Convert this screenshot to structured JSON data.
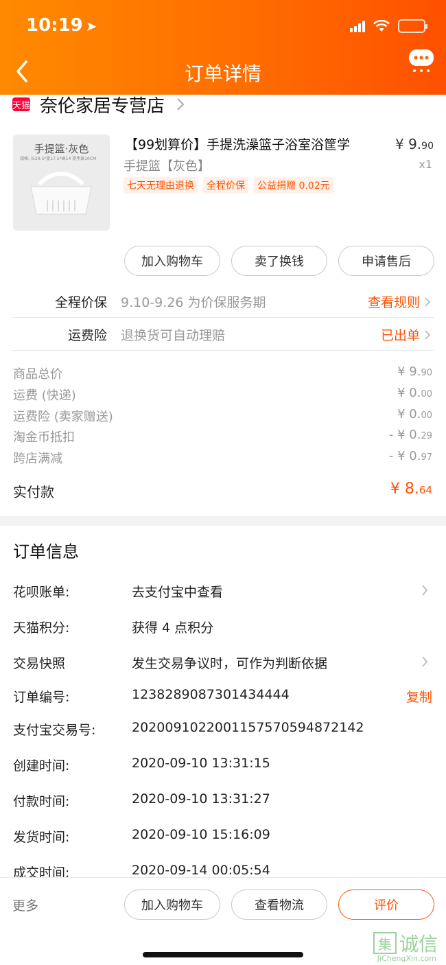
{
  "status_bar": {
    "time": "10:19",
    "location_glyph": "➤"
  },
  "header": {
    "title": "订单详情"
  },
  "store": {
    "badge": "天猫",
    "name": "奈伦家居专营店"
  },
  "product": {
    "thumb_title": "手提篮·灰色",
    "thumb_dims": "规格: 长29.5*宽17.5*高14 提手高10CM",
    "name": "【99划算价】手提洗澡篮子浴室浴筐学",
    "sku": "手提篮【灰色】",
    "tags": [
      "七天无理由退换",
      "全程价保",
      "公益捐赠 0.02元"
    ],
    "price_int": "¥ 9.",
    "price_dec": "90",
    "qty": "x1"
  },
  "actions": {
    "add_cart": "加入购物车",
    "resell": "卖了换钱",
    "after_sale": "申请售后"
  },
  "services": [
    {
      "label": "全程价保",
      "desc": "9.10-9.26 为价保服务期",
      "link": "查看规则"
    },
    {
      "label": "运费险",
      "desc": "退换货可自动理赔",
      "link": "已出单"
    }
  ],
  "price_list": [
    {
      "label": "商品总价",
      "int": "¥ 9.",
      "dec": "90"
    },
    {
      "label": "运费 (快递)",
      "int": "¥ 0.",
      "dec": "00"
    },
    {
      "label": "运费险 (卖家赠送)",
      "int": "¥ 0.",
      "dec": "00"
    },
    {
      "label": "淘金币抵扣",
      "int": "- ¥ 0.",
      "dec": "29"
    },
    {
      "label": "跨店满减",
      "int": "- ¥ 0.",
      "dec": "97"
    }
  ],
  "paid": {
    "label": "实付款",
    "int": "¥ 8.",
    "dec": "64"
  },
  "order_info": {
    "title": "订单信息",
    "rows": [
      {
        "label": "花呗账单:",
        "value": "去支付宝中查看"
      },
      {
        "label": "天猫积分:",
        "value": "获得 4 点积分"
      },
      {
        "label": "交易快照",
        "value": "发生交易争议时，可作为判断依据"
      },
      {
        "label": "订单编号:",
        "value": "1238289087301434444"
      },
      {
        "label": "支付宝交易号:",
        "value": "2020091022001157570594872142"
      },
      {
        "label": "创建时间:",
        "value": "2020-09-10 13:31:15"
      },
      {
        "label": "付款时间:",
        "value": "2020-09-10 13:31:27"
      },
      {
        "label": "发货时间:",
        "value": "2020-09-10 15:16:09"
      },
      {
        "label": "成交时间:",
        "value": "2020-09-14 00:05:54"
      }
    ],
    "copy": "复制"
  },
  "bottom_bar": {
    "more": "更多",
    "add_cart": "加入购物车",
    "logistics": "查看物流",
    "rate": "评价"
  },
  "watermark": {
    "badge": "集",
    "text": "诚信",
    "sub": "JiChengXin.com"
  },
  "colors": {
    "accent": "#ff5000",
    "header_start": "#ff8a00",
    "tmall_red": "#ff0036"
  }
}
